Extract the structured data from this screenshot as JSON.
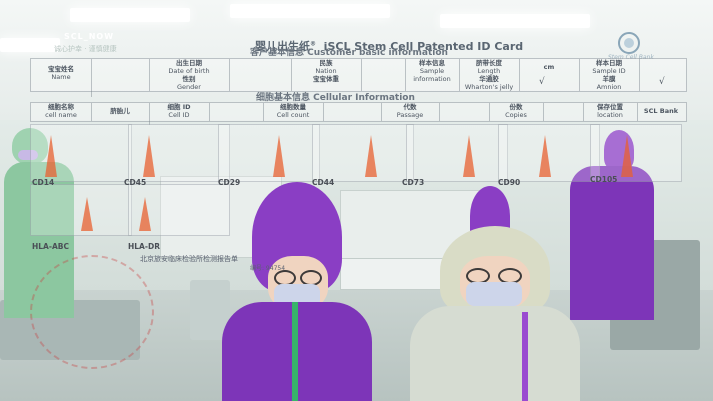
{
  "brand": {
    "name": "SCL_NOW",
    "slogan": "诚心护幸 · 谨慎健康",
    "logo_caption": "Stem Cell Bank"
  },
  "certificate": {
    "title_cn": "婴儿出生纸",
    "title_reg": "®",
    "title_en": "iSCL Stem Cell Patented ID Card"
  },
  "customer_info": {
    "header": "客户基本信息  Customer basic information",
    "row1": [
      {
        "cn": "宝宝姓名",
        "en": "Name"
      },
      {
        "cn": "出生日期",
        "en": "Date of birth"
      },
      {
        "cn": "民族",
        "en": "Nation"
      },
      {
        "cn": "样本信息",
        "en": "Sample"
      },
      {
        "cn": "脐带长度",
        "en": "Length"
      },
      {
        "cn": "cm",
        "en": ""
      },
      {
        "cn": "样本日期",
        "en": "Sample ID"
      }
    ],
    "row2": [
      {
        "cn": "性别",
        "en": "Gender"
      },
      {
        "cn": "宝宝体重",
        "en": "Weight"
      },
      {
        "cn": "information",
        "en": ""
      },
      {
        "cn": "华通胶",
        "en": "Wharton's jelly"
      },
      {
        "cn": "羊膜",
        "en": "Amnion"
      }
    ],
    "check_mark": "√"
  },
  "cell_info": {
    "header": "细胞基本信息  Cellular Information",
    "columns": [
      {
        "cn": "细胞名称",
        "en": "cell name"
      },
      {
        "cn": "脐胎儿",
        "en": ""
      },
      {
        "cn": "细胞 ID",
        "en": "Cell ID"
      },
      {
        "cn": "细胞数量",
        "en": "Cell count"
      },
      {
        "cn": "代数",
        "en": "Passage"
      },
      {
        "cn": "份数",
        "en": "Copies"
      },
      {
        "cn": "保存位置",
        "en": "location"
      },
      {
        "cn": "SCL Bank",
        "en": ""
      }
    ]
  },
  "markers": [
    "CD14",
    "CD45",
    "CD29",
    "CD44",
    "CD73",
    "CD90",
    "CD105",
    "HLA-ABC",
    "HLA-DR"
  ],
  "report": {
    "title": "北京旅安临床检验所检测报告单",
    "number": "编号: 94754"
  },
  "colors": {
    "purple_suit": "#7d35b8",
    "green_suit": "#8cc7a0",
    "histogram": "#e86030",
    "stripe": "#37b46a"
  }
}
